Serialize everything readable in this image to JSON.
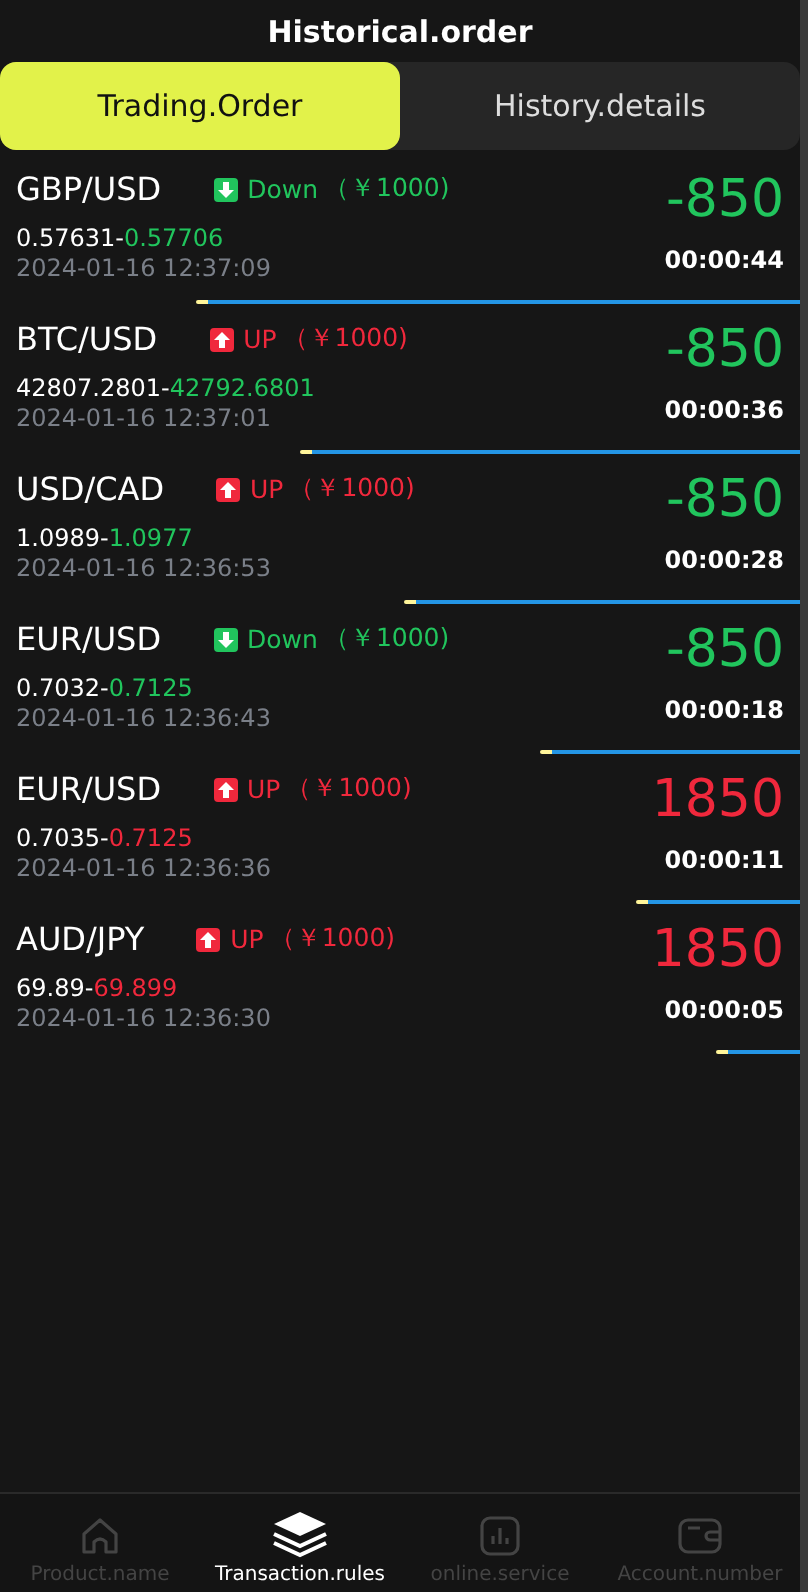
{
  "header": {
    "title": "Historical.order"
  },
  "tabs": [
    {
      "label": "Trading.Order",
      "selected": true
    },
    {
      "label": "History.details",
      "selected": false
    }
  ],
  "orders_separator": "-",
  "orders": [
    {
      "pair": "GBP/USD",
      "kind": "down",
      "direction_label": "Down",
      "stake": "（￥1000)",
      "open_price": "0.57631",
      "close_price": "0.57706",
      "time": "2024-01-16 12:37:09",
      "profit": "-850",
      "color": "#21c55d",
      "countdown": "00:00:44"
    },
    {
      "pair": "BTC/USD",
      "kind": "up",
      "direction_label": "UP",
      "stake": "（￥1000)",
      "open_price": "42807.2801",
      "close_price": "42792.6801",
      "time": "2024-01-16 12:37:01",
      "profit": "-850",
      "color": "#21c55d",
      "countdown": "00:00:36"
    },
    {
      "pair": "USD/CAD",
      "kind": "up",
      "direction_label": "UP",
      "stake": "（￥1000)",
      "open_price": "1.0989",
      "close_price": "1.0977",
      "time": "2024-01-16 12:36:53",
      "profit": "-850",
      "color": "#21c55d",
      "countdown": "00:00:28"
    },
    {
      "pair": "EUR/USD",
      "kind": "down",
      "direction_label": "Down",
      "stake": "（￥1000)",
      "open_price": "0.7032",
      "close_price": "0.7125",
      "time": "2024-01-16 12:36:43",
      "profit": "-850",
      "color": "#21c55d",
      "countdown": "00:00:18"
    },
    {
      "pair": "EUR/USD",
      "kind": "up",
      "direction_label": "UP",
      "stake": "（￥1000)",
      "open_price": "0.7035",
      "close_price": "0.7125",
      "time": "2024-01-16 12:36:36",
      "profit": "1850",
      "color": "#f0283c",
      "countdown": "00:00:11"
    },
    {
      "pair": "AUD/JPY",
      "kind": "up",
      "direction_label": "UP",
      "stake": "（￥1000)",
      "open_price": "69.89",
      "close_price": "69.899",
      "time": "2024-01-16 12:36:30",
      "profit": "1850",
      "color": "#f0283c",
      "countdown": "00:00:05"
    }
  ],
  "bottom_nav": [
    {
      "label": "Product.name",
      "kind": "home",
      "selected": false
    },
    {
      "label": "Transaction.rules",
      "kind": "layers",
      "selected": true
    },
    {
      "label": "online.service",
      "kind": "chart",
      "selected": false
    },
    {
      "label": "Account.number",
      "kind": "wallet",
      "selected": false
    }
  ]
}
